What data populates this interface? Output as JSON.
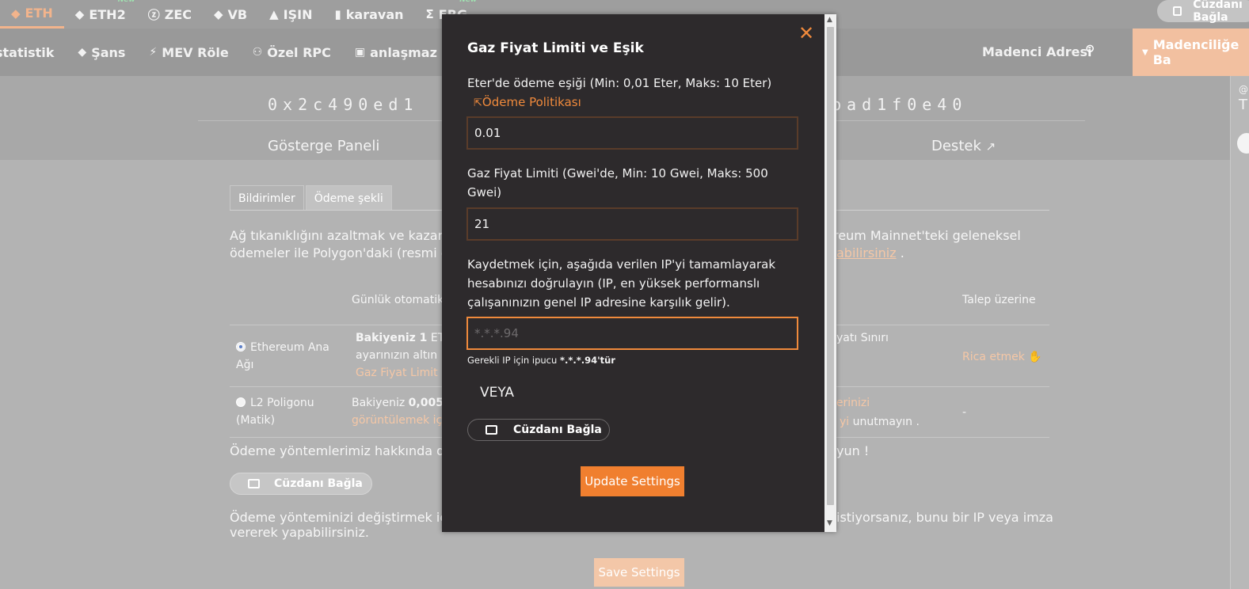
{
  "coins": [
    {
      "name": "ETH",
      "glyph": "◆",
      "active": true,
      "new": ""
    },
    {
      "name": "ETH2",
      "glyph": "◆",
      "active": false,
      "new": "New"
    },
    {
      "name": "ZEC",
      "glyph": "ⓩ",
      "active": false,
      "new": ""
    },
    {
      "name": "VB",
      "glyph": "◆",
      "active": false,
      "new": ""
    },
    {
      "name": "IŞIN",
      "glyph": "▲",
      "active": false,
      "new": ""
    },
    {
      "name": "karavan",
      "glyph": "▮",
      "active": false,
      "new": ""
    },
    {
      "name": "ERG",
      "glyph": "Σ",
      "active": false,
      "new": "New"
    }
  ],
  "topbar": {
    "wallet_label": "Cüzdanı Bağla"
  },
  "nav": {
    "items": [
      {
        "label": "statistik",
        "glyph": ""
      },
      {
        "label": "Şans",
        "glyph": "◆"
      },
      {
        "label": "MEV Röle",
        "glyph": "⚡"
      },
      {
        "label": "Özel RPC",
        "glyph": "⚇"
      },
      {
        "label": "anlaşmaz",
        "glyph": "▣"
      }
    ],
    "miner_address": "Madenci Adresi",
    "start_mining": "Madenciliğe Ba"
  },
  "address": {
    "left": "0x2c490ed1",
    "right": "bad1f0e40"
  },
  "dashboard_label": "Gösterge Paneli",
  "support_label": "Destek",
  "tabs": [
    "Bildirimler",
    "Ödeme şekli"
  ],
  "page": {
    "intro_line1_a": "Ağ tıkanıklığını azaltmak ve kazançl",
    "intro_line1_b": "reum Mainnet'teki geleneksel",
    "intro_line2_a": "ödemeler ile Polygon'daki (resmi ola",
    "intro_line2_b": "abilirsiniz",
    "intro_line2_c": ".",
    "col_daily": "Günlük otomatik",
    "col_on_request": "Talep üzerine",
    "row1_name": "Ethereum Ana Ağı",
    "row1_balance_a": "Bakiyeniz 1",
    "row1_balance_b": "ET",
    "row1_line2": "ayarınızın altın",
    "row1_link": "Gaz Fiyat Limit",
    "row1_right": "yatı Sınırı",
    "row1_request": "Rica etmek",
    "row2_name": "L2 Poligonu (Matik)",
    "row2_balance_a": "Bakiyeniz",
    "row2_balance_b": "0,005",
    "row2_link": "görüntülemek iç",
    "row2_right_link": "lerinizi",
    "row2_right2_a": "yi",
    "row2_right2_b": "unutmayın .",
    "row2_request": "-",
    "more_info_a": "Ödeme yöntemlerimiz hakkında daha f",
    "more_info_b": "yun !",
    "wallet_label": "Cüzdanı Bağla",
    "change_a": "Ödeme yönteminizi değiştirmek için bir",
    "change_b": "istiyorsanız, bunu bir IP veya imza",
    "change_line2": "vererek yapabilirsiniz.",
    "save_label": "Save Settings"
  },
  "modal": {
    "title": "Gaz Fiyat Limiti ve Eşik",
    "threshold_label": "Eter'de ödeme eşiği (Min: 0,01 Eter, Maks: 10 Eter)",
    "policy_link": "Ödeme Politikası",
    "threshold_value": "0.01",
    "gas_label": "Gaz Fiyat Limiti (Gwei'de, Min: 10 Gwei, Maks: 500 Gwei)",
    "gas_value": "21",
    "verify_label": "Kaydetmek için, aşağıda verilen IP'yi tamamlayarak hesabınızı doğrulayın (IP, en yüksek performanslı çalışanınızın genel IP adresine karşılık gelir).",
    "ip_placeholder": "*.*.*.94",
    "hint_prefix": "Gerekli IP için ipucu",
    "hint_value": "*.*.*.94'tür",
    "or_label": "VEYA",
    "wallet_label": "Cüzdanı Bağla",
    "update_label": "Update Settings"
  },
  "colors": {
    "accent": "#f07f2f",
    "modal_bg": "#2d2a2c",
    "overlay": "#b3b3b3"
  }
}
